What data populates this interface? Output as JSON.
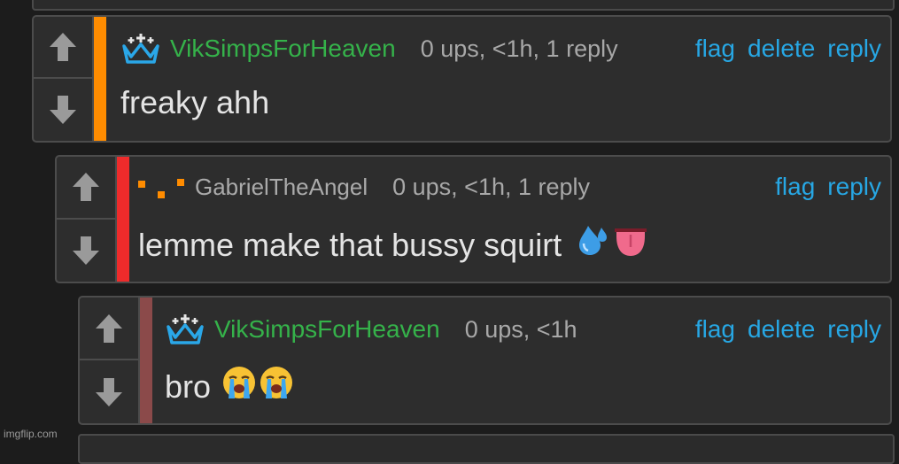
{
  "colors": {
    "username": "#35b24a",
    "link": "#27a7e4",
    "depth_1": "#ff8c00",
    "depth_2": "#ee2b2b",
    "depth_3": "#8b4a4a"
  },
  "comments": [
    {
      "username": "VikSimpsForHeaven",
      "badge_icon": "crown-icon",
      "stats": "0 ups, <1h, 1 reply",
      "actions": [
        "flag",
        "delete",
        "reply"
      ],
      "text": "freaky ahh"
    },
    {
      "username": "GabrielTheAngel",
      "badge_icon": "pixel-dots-icon",
      "stats": "0 ups, <1h, 1 reply",
      "actions": [
        "flag",
        "reply"
      ],
      "text": "lemme make that bussy squirt",
      "emojis": [
        "sweat-droplets-icon",
        "tongue-icon"
      ]
    },
    {
      "username": "VikSimpsForHeaven",
      "badge_icon": "crown-icon",
      "stats": "0 ups, <1h",
      "actions": [
        "flag",
        "delete",
        "reply"
      ],
      "text": "bro",
      "emojis": [
        "loudly-crying-face-icon",
        "loudly-crying-face-icon"
      ]
    }
  ],
  "watermark": "imgflip.com"
}
